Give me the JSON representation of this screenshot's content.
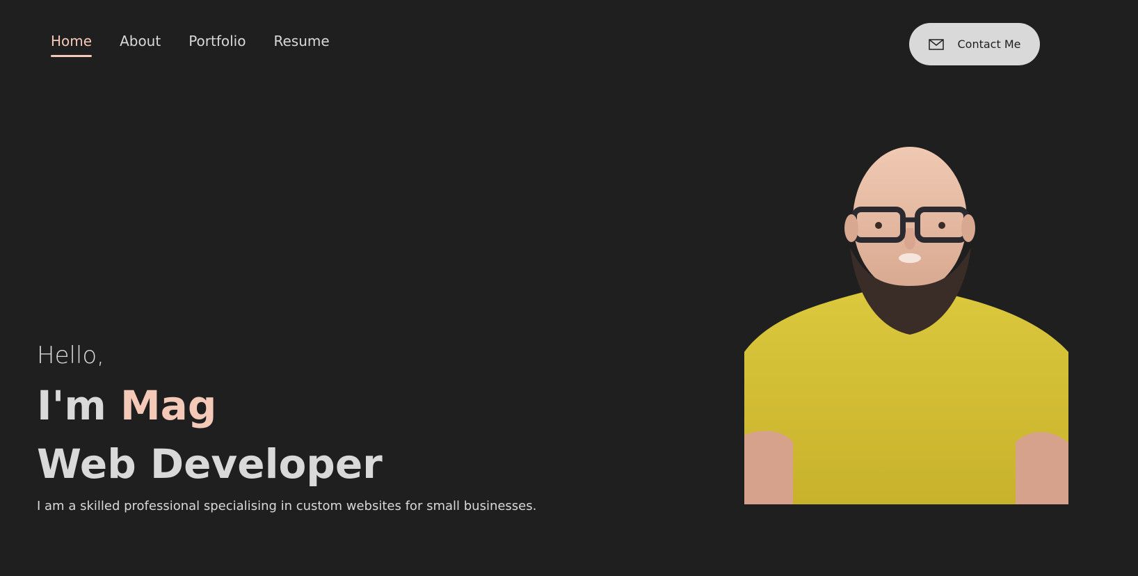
{
  "nav": {
    "items": [
      {
        "label": "Home",
        "active": true
      },
      {
        "label": "About",
        "active": false
      },
      {
        "label": "Portfolio",
        "active": false
      },
      {
        "label": "Resume",
        "active": false
      }
    ]
  },
  "contact": {
    "label": "Contact Me",
    "icon": "mail-icon"
  },
  "hero": {
    "greeting": "Hello,",
    "intro_prefix": "I'm ",
    "name": "Mag",
    "role": "Web Developer",
    "description": "I am a skilled professional specialising in custom websites for small businesses."
  },
  "colors": {
    "background": "#1f1f1f",
    "text": "#d9d9d9",
    "accent": "#f4c9b8",
    "button_bg": "#d9d9d9",
    "shirt": "#d8c43a"
  }
}
